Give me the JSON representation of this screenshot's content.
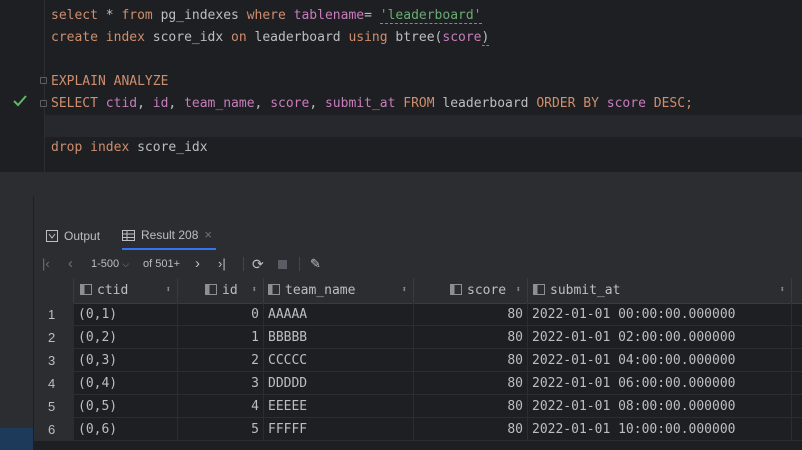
{
  "editor": {
    "line1": {
      "kw1": "select",
      "star": " * ",
      "kw2": "from",
      "ident": " pg_indexes ",
      "kw3": "where",
      "ident2": " tablename",
      "op": "= ",
      "str": "'leaderboard'",
      "end": ""
    },
    "line2": {
      "kw1": "create",
      "kw2": " index",
      "t1": " score_idx ",
      "kw3": "on",
      "t2": " leaderboard ",
      "kw4": "using",
      "t3": " btree(",
      "ident": "score",
      "t4": ")"
    },
    "line3": {
      "text": "EXPLAIN ANALYZE"
    },
    "line4": {
      "kw1": "SELECT",
      "c1": " ctid",
      "p1": ", ",
      "c2": "id",
      "p2": ", ",
      "c3": "team_name",
      "p3": ", ",
      "c4": "score",
      "p4": ", ",
      "c5": "submit_at",
      "kw2": " FROM",
      "t1": " leaderboard ",
      "kw3": "ORDER BY",
      "c6": " score",
      "kw4": " DESC",
      "end": ";"
    },
    "line5": {
      "kw1": "drop",
      "kw2": " index",
      "t1": " score_idx"
    }
  },
  "tabs": {
    "output": "Output",
    "result": "Result 208"
  },
  "toolbar": {
    "range": "1-500",
    "of_total": "of 501+"
  },
  "columns": [
    "ctid",
    "id",
    "team_name",
    "score",
    "submit_at"
  ],
  "rows": [
    {
      "n": "1",
      "ctid": "(0,1)",
      "id": "0",
      "team_name": "AAAAA",
      "score": "80",
      "submit_at": "2022-01-01 00:00:00.000000"
    },
    {
      "n": "2",
      "ctid": "(0,2)",
      "id": "1",
      "team_name": "BBBBB",
      "score": "80",
      "submit_at": "2022-01-01 02:00:00.000000"
    },
    {
      "n": "3",
      "ctid": "(0,3)",
      "id": "2",
      "team_name": "CCCCC",
      "score": "80",
      "submit_at": "2022-01-01 04:00:00.000000"
    },
    {
      "n": "4",
      "ctid": "(0,4)",
      "id": "3",
      "team_name": "DDDDD",
      "score": "80",
      "submit_at": "2022-01-01 06:00:00.000000"
    },
    {
      "n": "5",
      "ctid": "(0,5)",
      "id": "4",
      "team_name": "EEEEE",
      "score": "80",
      "submit_at": "2022-01-01 08:00:00.000000"
    },
    {
      "n": "6",
      "ctid": "(0,6)",
      "id": "5",
      "team_name": "FFFFF",
      "score": "80",
      "submit_at": "2022-01-01 10:00:00.000000"
    }
  ],
  "colors": {
    "keyword": "#cf8e6d",
    "identifier": "#c77dbb",
    "string": "#6aab73",
    "accent": "#3574f0"
  }
}
